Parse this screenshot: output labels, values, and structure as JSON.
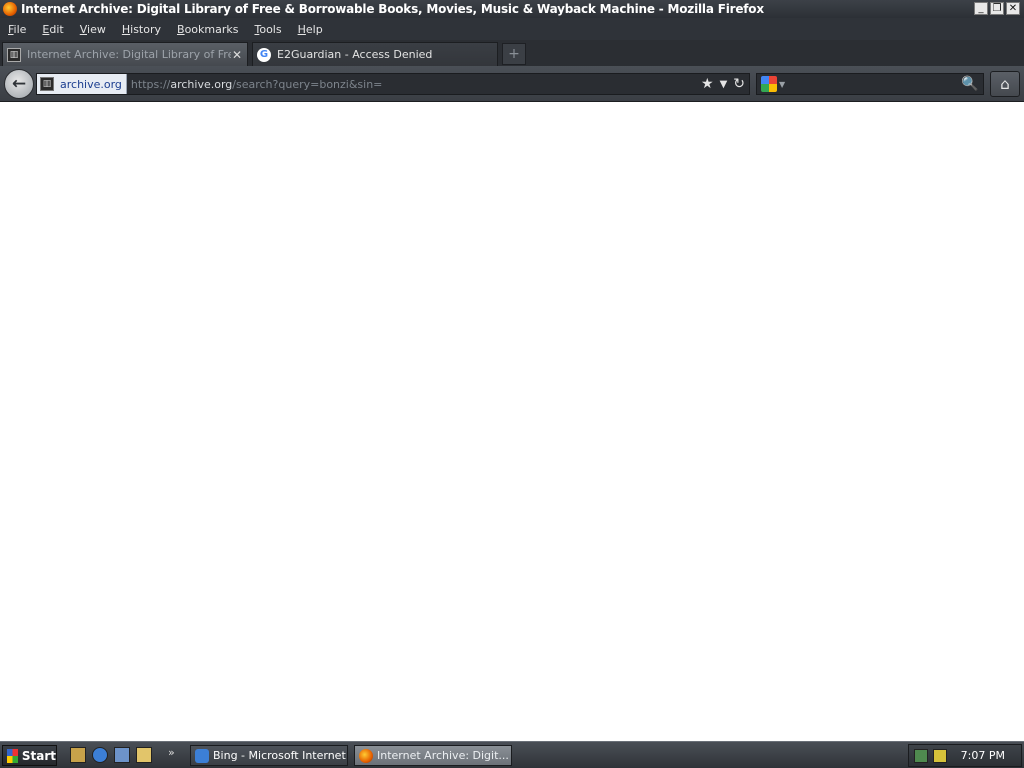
{
  "window": {
    "title": "Internet Archive: Digital Library of Free & Borrowable Books, Movies, Music & Wayback Machine - Mozilla Firefox",
    "minimize": "_",
    "restore": "❐",
    "close": "✕"
  },
  "menu": [
    {
      "label": "File",
      "underline": "F",
      "rest": "ile"
    },
    {
      "label": "Edit",
      "underline": "E",
      "rest": "dit"
    },
    {
      "label": "View",
      "underline": "V",
      "rest": "iew"
    },
    {
      "label": "History",
      "underline": "H",
      "rest": "istory"
    },
    {
      "label": "Bookmarks",
      "underline": "B",
      "rest": "ookmarks"
    },
    {
      "label": "Tools",
      "underline": "T",
      "rest": "ools"
    },
    {
      "label": "Help",
      "underline": "H",
      "rest": "elp"
    }
  ],
  "tabs": [
    {
      "label": "Internet Archive: Digital Library of Free ...",
      "icon": "archive-icon",
      "close": "✕"
    },
    {
      "label": "E2Guardian - Access Denied",
      "icon": "google-icon",
      "close": "✕"
    }
  ],
  "newtab_label": "+",
  "navbar": {
    "back": "←",
    "identity_host": "archive.org",
    "url_prefix": "https://",
    "url_host": "archive.org",
    "url_path": "/search?query=bonzi&sin=",
    "bookmark_star": "★",
    "dropdown": "▼",
    "reload": "↻",
    "search_placeholder": "",
    "search_icon": "magnifier-icon",
    "home": "⌂"
  },
  "taskbar": {
    "start_label": "Start",
    "more": "»",
    "items": [
      {
        "label": "Bing - Microsoft Internet ...",
        "icon": "ie-icon"
      },
      {
        "label": "Internet Archive: Digit...",
        "icon": "firefox-icon"
      }
    ],
    "clock": "7:07 PM"
  },
  "colors": {
    "accent_identity": "#1a3d8f",
    "chrome_dark": "#2f3339"
  }
}
